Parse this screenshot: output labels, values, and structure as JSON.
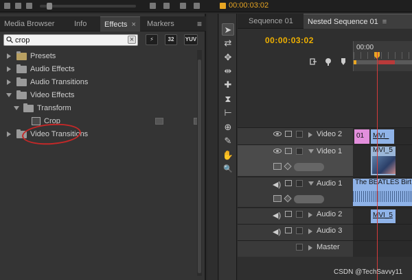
{
  "top": {
    "timecode": "00:00:03:02"
  },
  "left_panel": {
    "tabs": [
      {
        "label": "Media Browser"
      },
      {
        "label": "Info"
      },
      {
        "label": "Effects",
        "close": "×"
      },
      {
        "label": "Markers"
      }
    ],
    "menu_glyph": "≡",
    "search": {
      "value": "crop",
      "placeholder": ""
    },
    "search_buttons": [
      "⚡",
      "32",
      "YUV"
    ],
    "tree": [
      {
        "label": "Presets",
        "expanded": false
      },
      {
        "label": "Audio Effects",
        "expanded": false
      },
      {
        "label": "Audio Transitions",
        "expanded": false
      },
      {
        "label": "Video Effects",
        "expanded": true
      },
      {
        "label": "Transform",
        "expanded": true
      },
      {
        "label": "Crop"
      },
      {
        "label": "Video Transitions",
        "expanded": false
      }
    ]
  },
  "timeline": {
    "tabs": [
      {
        "label": "Sequence 01"
      },
      {
        "label": "Nested Sequence 01",
        "close": "≡"
      }
    ],
    "timecode": "00:00:03:02",
    "ruler_label": "00:00",
    "tracks": {
      "video2": {
        "name": "Video 2",
        "clips": [
          "01",
          "MVI_"
        ]
      },
      "video1": {
        "name": "Video 1",
        "clips": [
          "MVI_5"
        ]
      },
      "audio1": {
        "name": "Audio 1",
        "clips": [
          "The BEATLES Birt"
        ]
      },
      "audio2": {
        "name": "Audio 2",
        "clips": [
          "MVI_5"
        ]
      },
      "audio3": {
        "name": "Audio 3"
      },
      "master": {
        "name": "Master"
      }
    }
  },
  "tools": [
    "➤",
    "⇄",
    "✥",
    "⇹",
    "✚",
    "⧗",
    "⊢",
    "⊕",
    "✎",
    "✋",
    "🔍"
  ],
  "watermark": "CSDN @TechSavvy11",
  "colors": {
    "accent": "#e8a623",
    "playhead": "#d53b3b",
    "annotation": "#c42828"
  }
}
